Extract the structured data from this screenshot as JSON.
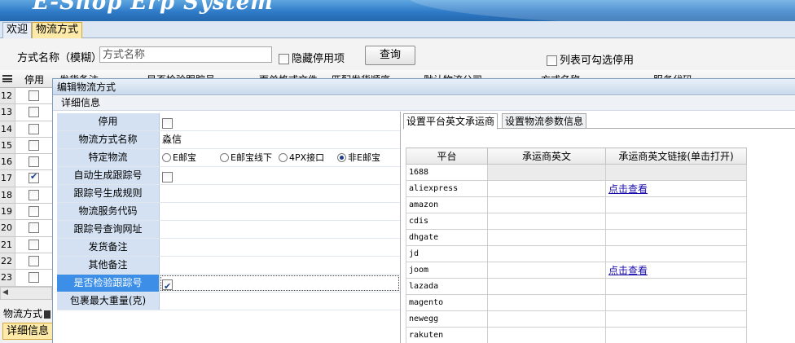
{
  "banner": {
    "title": "E-Shop Erp System"
  },
  "main_tabs": [
    {
      "label": "欢迎",
      "active": false
    },
    {
      "label": "物流方式",
      "active": true
    }
  ],
  "search": {
    "label": "方式名称（模糊）",
    "input_placeholder": "方式名称",
    "hide_disabled_label": "隐藏停用项",
    "query_button": "查询",
    "list_checkable_label": "列表可勾选停用"
  },
  "grid": {
    "columns": [
      "停用",
      "发货备注",
      "是否检验跟踪号",
      "面单格式文件",
      "匹配发货顺序",
      "默认物流公司",
      "方式名称",
      "服务代码"
    ],
    "rows": [
      {
        "num": "12",
        "disabled": false
      },
      {
        "num": "13",
        "disabled": false
      },
      {
        "num": "14",
        "disabled": false
      },
      {
        "num": "15",
        "disabled": false
      },
      {
        "num": "16",
        "disabled": false
      },
      {
        "num": "17",
        "disabled": true
      },
      {
        "num": "18",
        "disabled": false
      },
      {
        "num": "19",
        "disabled": false
      },
      {
        "num": "20",
        "disabled": false
      },
      {
        "num": "21",
        "disabled": false
      },
      {
        "num": "22",
        "disabled": false
      },
      {
        "num": "23",
        "disabled": false
      }
    ]
  },
  "bottom": {
    "label": "物流方式",
    "tab": "详细信息"
  },
  "dialog": {
    "title": "编辑物流方式",
    "section": "详细信息",
    "fields": {
      "disabled_label": "停用",
      "name_label": "物流方式名称",
      "name_value": "淼信",
      "special_label": "特定物流",
      "special_options": [
        "E邮宝",
        "E邮宝线下",
        "4PX接口",
        "非E邮宝"
      ],
      "special_selected": 3,
      "auto_track_label": "自动生成跟踪号",
      "track_rule_label": "跟踪号生成规则",
      "service_code_label": "物流服务代码",
      "track_url_label": "跟踪号查询网址",
      "ship_note_label": "发货备注",
      "other_note_label": "其他备注",
      "verify_track_label": "是否检验跟踪号",
      "verify_track_checked": true,
      "max_weight_label": "包裹最大重量(克)"
    },
    "right_tabs": [
      {
        "label": "设置平台英文承运商",
        "active": true
      },
      {
        "label": "设置物流参数信息",
        "active": false
      }
    ],
    "carrier_table": {
      "headers": [
        "平台",
        "承运商英文",
        "承运商英文链接(单击打开)"
      ],
      "rows": [
        {
          "platform": "1688",
          "carrier": "",
          "link": ""
        },
        {
          "platform": "aliexpress",
          "carrier": "",
          "link": "点击查看"
        },
        {
          "platform": "amazon",
          "carrier": "",
          "link": ""
        },
        {
          "platform": "cdis",
          "carrier": "",
          "link": ""
        },
        {
          "platform": "dhgate",
          "carrier": "",
          "link": ""
        },
        {
          "platform": "jd",
          "carrier": "",
          "link": ""
        },
        {
          "platform": "joom",
          "carrier": "",
          "link": "点击查看"
        },
        {
          "platform": "lazada",
          "carrier": "",
          "link": ""
        },
        {
          "platform": "magento",
          "carrier": "",
          "link": ""
        },
        {
          "platform": "newegg",
          "carrier": "",
          "link": ""
        },
        {
          "platform": "rakuten",
          "carrier": "",
          "link": ""
        }
      ]
    }
  }
}
